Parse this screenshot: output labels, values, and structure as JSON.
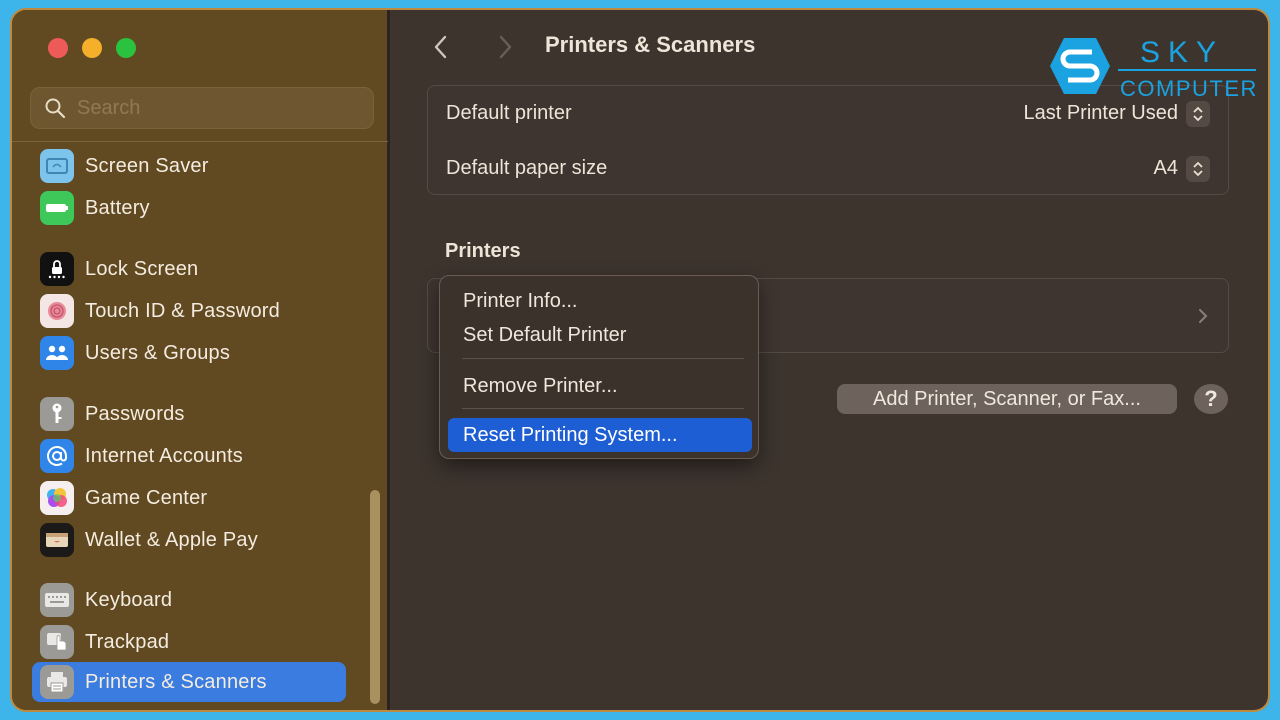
{
  "window": {
    "title": "Printers & Scanners"
  },
  "sidebar": {
    "search_placeholder": "Search",
    "items": [
      {
        "label": "Screen Saver",
        "icon": "screen-saver-icon",
        "color": "#7cc4ec"
      },
      {
        "label": "Battery",
        "icon": "battery-icon",
        "color": "#3ec85a"
      },
      {
        "label": "Lock Screen",
        "icon": "lock-screen-icon",
        "color": "#111111"
      },
      {
        "label": "Touch ID & Password",
        "icon": "fingerprint-icon",
        "color": "#f3e6e4"
      },
      {
        "label": "Users & Groups",
        "icon": "users-icon",
        "color": "#2f86e8"
      },
      {
        "label": "Passwords",
        "icon": "key-icon",
        "color": "#9c9a97"
      },
      {
        "label": "Internet Accounts",
        "icon": "at-sign-icon",
        "color": "#2f86e8"
      },
      {
        "label": "Game Center",
        "icon": "game-center-icon",
        "color": "#f5f0ef"
      },
      {
        "label": "Wallet & Apple Pay",
        "icon": "wallet-icon",
        "color": "#1c1a18"
      },
      {
        "label": "Keyboard",
        "icon": "keyboard-icon",
        "color": "#9c9a97"
      },
      {
        "label": "Trackpad",
        "icon": "trackpad-icon",
        "color": "#9c9a97"
      },
      {
        "label": "Printers & Scanners",
        "icon": "printer-icon",
        "color": "#9c9a97",
        "selected": true
      }
    ]
  },
  "main": {
    "defaults": {
      "default_printer_label": "Default printer",
      "default_printer_value": "Last Printer Used",
      "paper_size_label": "Default paper size",
      "paper_size_value": "A4"
    },
    "printers_section_title": "Printers",
    "add_button_label": "Add Printer, Scanner, or Fax...",
    "help_button_label": "?"
  },
  "context_menu": {
    "items": [
      {
        "label": "Printer Info..."
      },
      {
        "label": "Set Default Printer"
      },
      {
        "label": "Remove Printer..."
      },
      {
        "label": "Reset Printing System...",
        "highlighted": true
      }
    ]
  },
  "watermark": {
    "brand_top": "SKY",
    "brand_bottom": "COMPUTER",
    "color": "#1aa3e0"
  },
  "colors": {
    "accent": "#3a7ce0",
    "menu_highlight": "#1e5ed4",
    "sidebar_bg": "#614a21",
    "content_bg": "#3d342e"
  }
}
